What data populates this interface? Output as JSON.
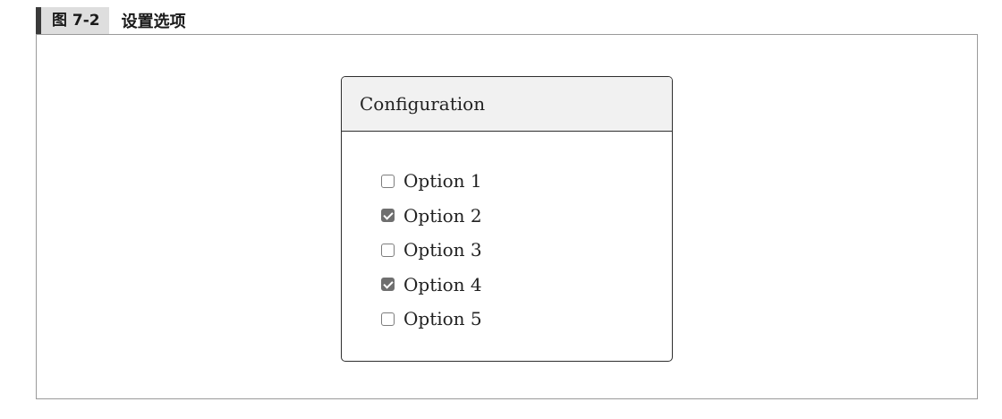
{
  "figure": {
    "label": "图 7-2",
    "title": "设置选项"
  },
  "panel": {
    "title": "Configuration",
    "options": [
      {
        "label": "Option 1",
        "checked": false
      },
      {
        "label": "Option 2",
        "checked": true
      },
      {
        "label": "Option 3",
        "checked": false
      },
      {
        "label": "Option 4",
        "checked": true
      },
      {
        "label": "Option 5",
        "checked": false
      }
    ]
  },
  "colors": {
    "checked_fill": "#6f6f6f",
    "header_bg": "#f1f1f1",
    "border": "#2e2e2e"
  }
}
